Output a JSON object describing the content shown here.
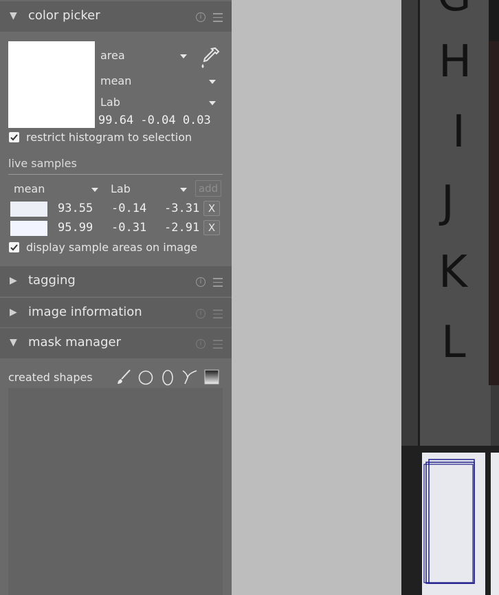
{
  "color_picker": {
    "title": "color picker",
    "area_label": "area",
    "mean_label": "mean",
    "colorspace_label": "Lab",
    "values": "99.64 -0.04 0.03",
    "restrict_label": "restrict histogram to selection",
    "swatch_color": "#ffffff"
  },
  "live_samples": {
    "heading": "live samples",
    "stat_label": "mean",
    "colorspace_label": "Lab",
    "add_label": "add",
    "samples": [
      {
        "color": "#eceff6",
        "l": "93.55",
        "a": "-0.14",
        "b": "-3.31",
        "remove": "X"
      },
      {
        "color": "#f2f5ff",
        "l": "95.99",
        "a": "-0.31",
        "b": "-2.91",
        "remove": "X"
      }
    ],
    "display_areas_label": "display sample areas on image"
  },
  "modules": [
    {
      "title": "tagging"
    },
    {
      "title": "image information"
    },
    {
      "title": "mask manager"
    }
  ],
  "mask_manager": {
    "created_shapes_label": "created shapes"
  },
  "image": {
    "letters": [
      "H",
      "I",
      "J",
      "K",
      "L"
    ]
  },
  "icons": {
    "info": "i",
    "expand": "▶",
    "collapse": "▼"
  }
}
